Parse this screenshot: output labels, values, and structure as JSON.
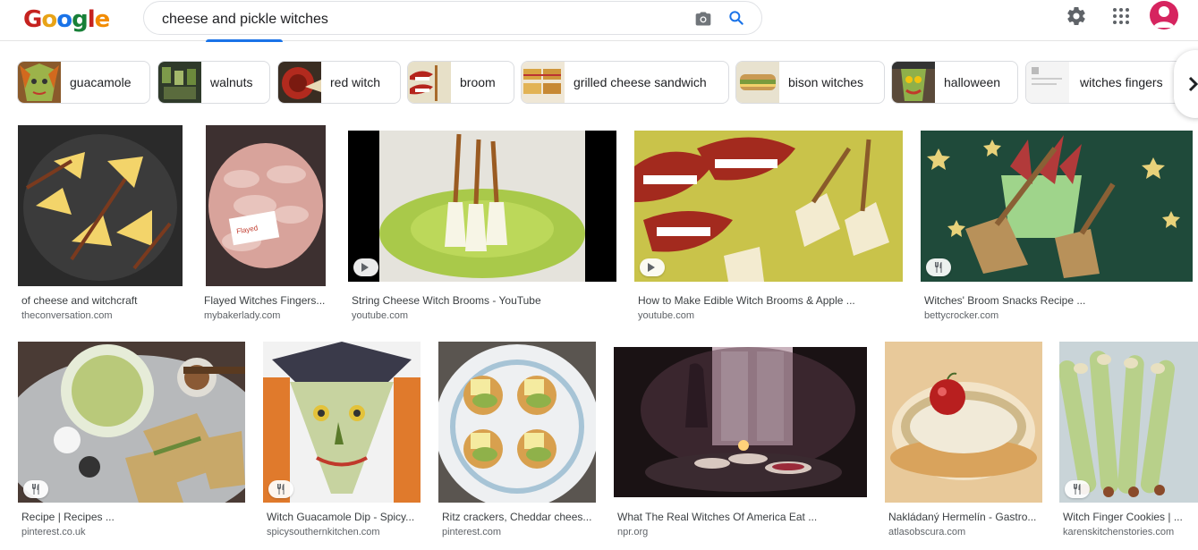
{
  "search": {
    "query": "cheese and pickle witches"
  },
  "logo": {
    "letters": [
      "G",
      "o",
      "o",
      "g",
      "l",
      "e"
    ]
  },
  "chips": [
    {
      "label": "guacamole"
    },
    {
      "label": "walnuts"
    },
    {
      "label": "red witch"
    },
    {
      "label": "broom"
    },
    {
      "label": "grilled cheese sandwich"
    },
    {
      "label": "bison witches"
    },
    {
      "label": "halloween"
    },
    {
      "label": "witches fingers"
    }
  ],
  "results": [
    {
      "title": "of cheese and witchcraft",
      "source": "theconversation.com"
    },
    {
      "title": "Flayed Witches Fingers...",
      "source": "mybakerlady.com"
    },
    {
      "title": "String Cheese Witch Brooms - YouTube",
      "source": "youtube.com"
    },
    {
      "title": "How to Make Edible Witch Brooms & Apple ...",
      "source": "youtube.com"
    },
    {
      "title": "Witches' Broom Snacks Recipe ...",
      "source": "bettycrocker.com"
    },
    {
      "title": "Recipe | Recipes ...",
      "source": "pinterest.co.uk"
    },
    {
      "title": "Witch Guacamole Dip - Spicy...",
      "source": "spicysouthernkitchen.com"
    },
    {
      "title": "Ritz crackers, Cheddar chees...",
      "source": "pinterest.com"
    },
    {
      "title": "What The Real Witches Of America Eat ...",
      "source": "npr.org"
    },
    {
      "title": "Nakládaný Hermelín - Gastro...",
      "source": "atlasobscura.com"
    },
    {
      "title": "Witch Finger Cookies | ...",
      "source": "karenskitchenstories.com"
    }
  ],
  "colors": {
    "accent": "#1a73e8",
    "avatar": "#d6245f"
  }
}
